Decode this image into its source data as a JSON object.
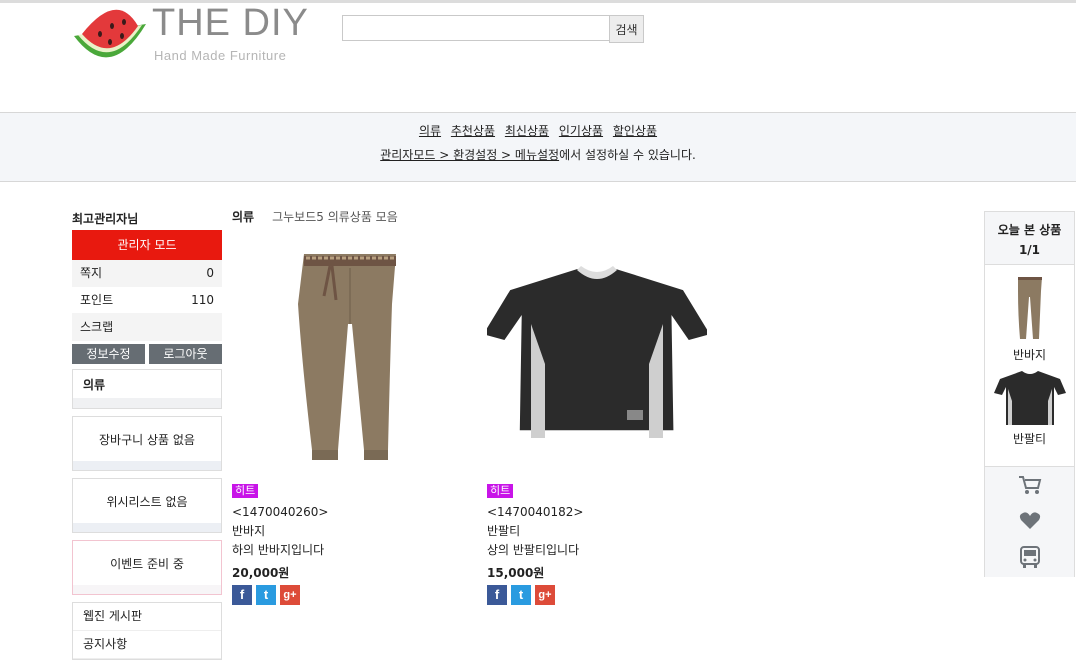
{
  "header": {
    "logo_title": "THE DIY",
    "logo_subtitle": "Hand Made Furniture",
    "search_placeholder": "",
    "search_button": "검색"
  },
  "nav": {
    "links": [
      "의류",
      "추천상품",
      "최신상품",
      "인기상품",
      "할인상품"
    ],
    "note_link": "관리자모드 > 환경설정 > 메뉴설정",
    "note_text": "에서 설정하실 수 있습니다."
  },
  "sidebar": {
    "username": "최고관리자님",
    "admin_mode": "관리자 모드",
    "stats": [
      {
        "label": "쪽지",
        "value": "0"
      },
      {
        "label": "포인트",
        "value": "110"
      },
      {
        "label": "스크랩",
        "value": ""
      }
    ],
    "edit_info": "정보수정",
    "logout": "로그아웃",
    "category": "의류",
    "cart_empty": "장바구니 상품 없음",
    "wishlist_empty": "위시리스트 없음",
    "event": "이벤트 준비 중",
    "boards": [
      "웹진 게시판",
      "공지사항"
    ]
  },
  "main": {
    "breadcrumb_title": "의류",
    "breadcrumb_sub": "그누보드5 의류상품 모음",
    "products": [
      {
        "badge": "히트",
        "code": "<1470040260>",
        "name": "반바지",
        "desc": "하의 반바지입니다",
        "price": "20,000원"
      },
      {
        "badge": "히트",
        "code": "<1470040182>",
        "name": "반팔티",
        "desc": "상의 반팔티입니다",
        "price": "15,000원"
      }
    ]
  },
  "today_viewed": {
    "title": "오늘 본 상품",
    "count": "1/1",
    "items": [
      "반바지",
      "반팔티"
    ]
  },
  "colors": {
    "admin_red": "#e8190f",
    "badge_purple": "#c814e8"
  }
}
